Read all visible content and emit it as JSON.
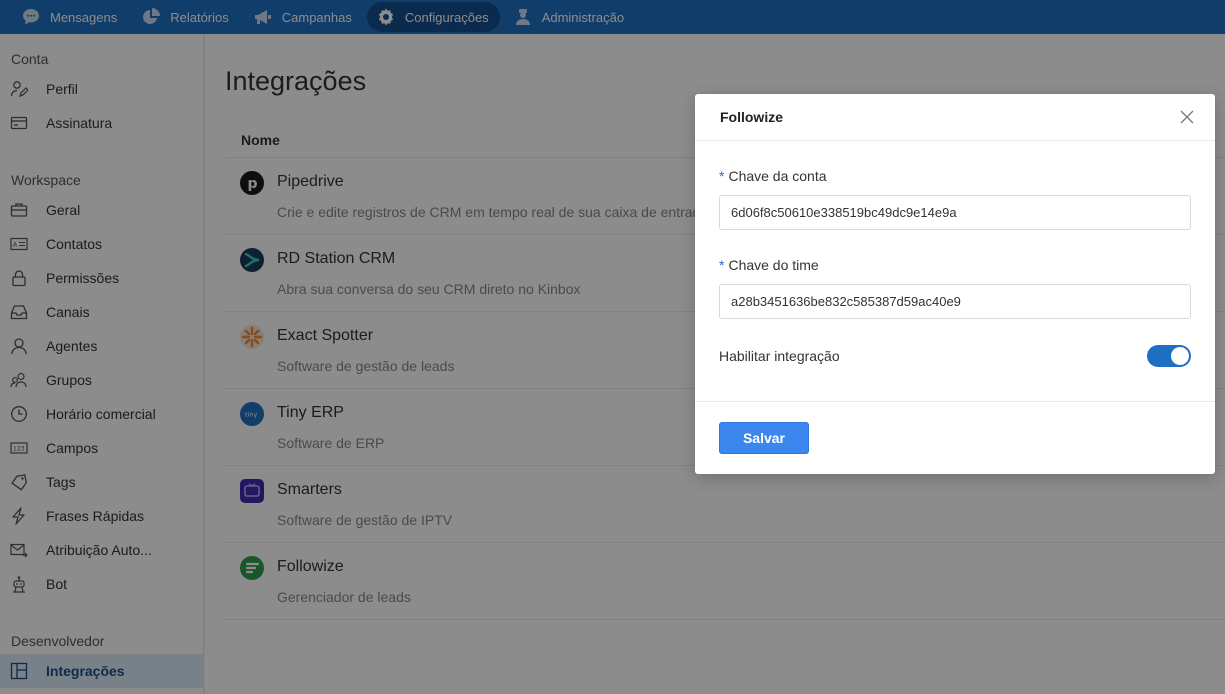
{
  "topnav": {
    "items": [
      {
        "label": "Mensagens",
        "icon": "chat-bubble-icon"
      },
      {
        "label": "Relatórios",
        "icon": "pie-chart-icon"
      },
      {
        "label": "Campanhas",
        "icon": "megaphone-icon"
      },
      {
        "label": "Configurações",
        "icon": "gear-icon",
        "active": true
      },
      {
        "label": "Administração",
        "icon": "user-admin-icon"
      }
    ]
  },
  "sidebar": {
    "sections": [
      {
        "title": "Conta",
        "items": [
          {
            "label": "Perfil",
            "icon": "user-edit-icon"
          },
          {
            "label": "Assinatura",
            "icon": "credit-card-icon"
          }
        ]
      },
      {
        "title": "Workspace",
        "items": [
          {
            "label": "Geral",
            "icon": "briefcase-icon"
          },
          {
            "label": "Contatos",
            "icon": "contact-card-icon"
          },
          {
            "label": "Permissões",
            "icon": "lock-icon"
          },
          {
            "label": "Canais",
            "icon": "inbox-icon"
          },
          {
            "label": "Agentes",
            "icon": "agent-icon"
          },
          {
            "label": "Grupos",
            "icon": "group-icon"
          },
          {
            "label": "Horário comercial",
            "icon": "clock-icon"
          },
          {
            "label": "Campos",
            "icon": "fields-icon"
          },
          {
            "label": "Tags",
            "icon": "tag-icon"
          },
          {
            "label": "Frases Rápidas",
            "icon": "lightning-icon"
          },
          {
            "label": "Atribuição Auto...",
            "icon": "auto-assign-icon"
          },
          {
            "label": "Bot",
            "icon": "robot-icon"
          }
        ]
      },
      {
        "title": "Desenvolvedor",
        "items": [
          {
            "label": "Integrações",
            "icon": "integrations-icon",
            "active": true
          }
        ]
      }
    ]
  },
  "main": {
    "title": "Integrações",
    "column_header": "Nome",
    "integrations": [
      {
        "name": "Pipedrive",
        "description": "Crie e edite registros de CRM em tempo real de sua caixa de entrada",
        "icon": "pipedrive-logo",
        "color": "#1a1a1a"
      },
      {
        "name": "RD Station CRM",
        "description": "Abra sua conversa do seu CRM direto no Kinbox",
        "icon": "rdstation-logo",
        "color": "#1c3d5a"
      },
      {
        "name": "Exact Spotter",
        "description": "Software de gestão de leads",
        "icon": "exact-spotter-logo",
        "color": "#f08a3c"
      },
      {
        "name": "Tiny ERP",
        "description": "Software de ERP",
        "icon": "tiny-logo",
        "color": "#1e6fc2"
      },
      {
        "name": "Smarters",
        "description": "Software de gestão de IPTV",
        "icon": "smarters-logo",
        "color": "#3b2fb0"
      },
      {
        "name": "Followize",
        "description": "Gerenciador de leads",
        "icon": "followize-logo",
        "color": "#2e9e4f"
      }
    ]
  },
  "modal": {
    "title": "Followize",
    "required_mark": "*",
    "fields": [
      {
        "label": "Chave da conta",
        "value": "6d06f8c50610e338519bc49dc9e14e9a"
      },
      {
        "label": "Chave do time",
        "value": "a28b3451636be832c585387d59ac40e9"
      }
    ],
    "toggle_label": "Habilitar integração",
    "toggle_enabled": true,
    "save_label": "Salvar"
  },
  "colors": {
    "primary": "#1e6fc2",
    "button": "#3c87ee"
  }
}
